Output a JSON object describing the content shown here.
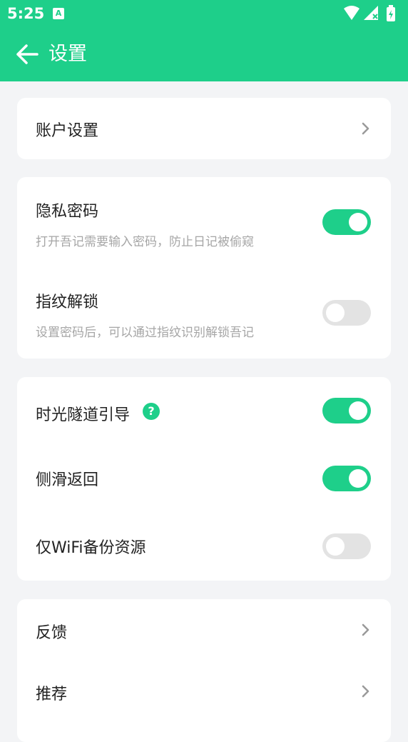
{
  "status_bar": {
    "time": "5:25",
    "notification_icon": "A"
  },
  "header": {
    "title": "设置"
  },
  "account": {
    "label": "账户设置"
  },
  "privacy": {
    "title": "隐私密码",
    "desc": "打开吾记需要输入密码，防止日记被偷窥",
    "enabled": true
  },
  "fingerprint": {
    "title": "指纹解锁",
    "desc": "设置密码后，可以通过指纹识别解锁吾记",
    "enabled": false
  },
  "tunnel_guide": {
    "title": "时光隧道引导",
    "help_icon": "?",
    "enabled": true
  },
  "swipe_back": {
    "title": "侧滑返回",
    "enabled": true
  },
  "wifi_backup": {
    "title": "仅WiFi备份资源",
    "enabled": false
  },
  "misc": {
    "feedback": "反馈",
    "recommend": "推荐"
  },
  "colors": {
    "accent": "#1ecf8a",
    "background": "#f3f4f6",
    "toggle_off": "#e3e3e3"
  }
}
